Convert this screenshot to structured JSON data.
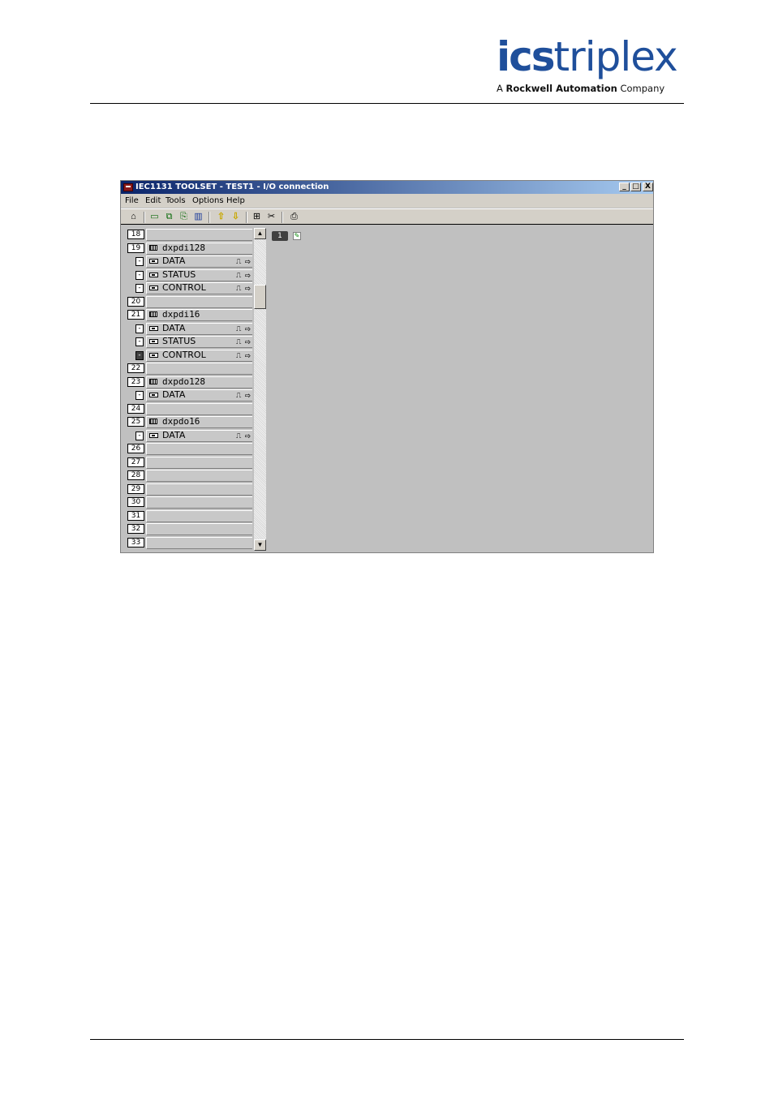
{
  "header": {
    "logo_bold": "ics",
    "logo_light": "triplex",
    "logo_sub_prefix": "A ",
    "logo_sub_bold": "Rockwell Automation",
    "logo_sub_suffix": " Company"
  },
  "window": {
    "title": "IEC1131 TOOLSET - TEST1 - I/O connection",
    "minimize": "_",
    "maximize": "□",
    "close": "X"
  },
  "menu": [
    "File",
    "Edit",
    "Tools",
    "Options",
    "Help"
  ],
  "toolbar_icons": [
    "open-icon",
    "module-icon",
    "copy-module-icon",
    "paste-module-icon",
    "delete-icon",
    "up-arrow-icon",
    "down-arrow-icon",
    "properties-icon",
    "cut-icon",
    "print-icon"
  ],
  "rows": [
    {
      "type": "slot",
      "num": "18",
      "label": ""
    },
    {
      "type": "module",
      "num": "19",
      "label": "dxpdi128"
    },
    {
      "type": "channel",
      "label": "DATA"
    },
    {
      "type": "channel",
      "label": "STATUS"
    },
    {
      "type": "channel",
      "label": "CONTROL"
    },
    {
      "type": "slot",
      "num": "20",
      "label": ""
    },
    {
      "type": "module",
      "num": "21",
      "label": "dxpdi16"
    },
    {
      "type": "channel",
      "label": "DATA"
    },
    {
      "type": "channel",
      "label": "STATUS"
    },
    {
      "type": "channel",
      "label": "CONTROL",
      "selected": true
    },
    {
      "type": "slot",
      "num": "22",
      "label": ""
    },
    {
      "type": "module",
      "num": "23",
      "label": "dxpdo128"
    },
    {
      "type": "channel",
      "label": "DATA"
    },
    {
      "type": "slot",
      "num": "24",
      "label": ""
    },
    {
      "type": "module",
      "num": "25",
      "label": "dxpdo16"
    },
    {
      "type": "channel",
      "label": "DATA"
    },
    {
      "type": "slot",
      "num": "26",
      "label": ""
    },
    {
      "type": "slot",
      "num": "27",
      "label": ""
    },
    {
      "type": "slot",
      "num": "28",
      "label": ""
    },
    {
      "type": "slot",
      "num": "29",
      "label": ""
    },
    {
      "type": "slot",
      "num": "30",
      "label": ""
    },
    {
      "type": "slot",
      "num": "31",
      "label": ""
    },
    {
      "type": "slot",
      "num": "32",
      "label": ""
    },
    {
      "type": "slot",
      "num": "33",
      "label": ""
    }
  ],
  "channel_ctrl": "⎍ ⇨",
  "workspace": {
    "rack_number": "1"
  }
}
